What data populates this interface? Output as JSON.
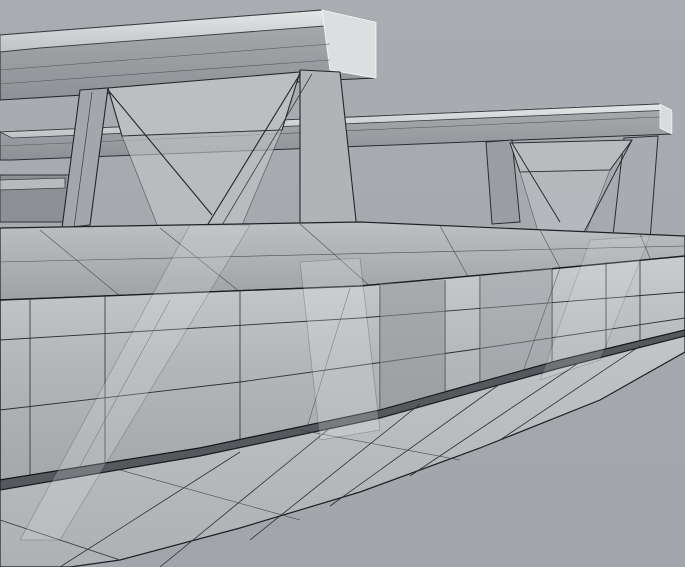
{
  "viewport": {
    "name": "3d-viewport",
    "background": "#a6aaae",
    "content": "shaded-wireframe-hull-model"
  }
}
